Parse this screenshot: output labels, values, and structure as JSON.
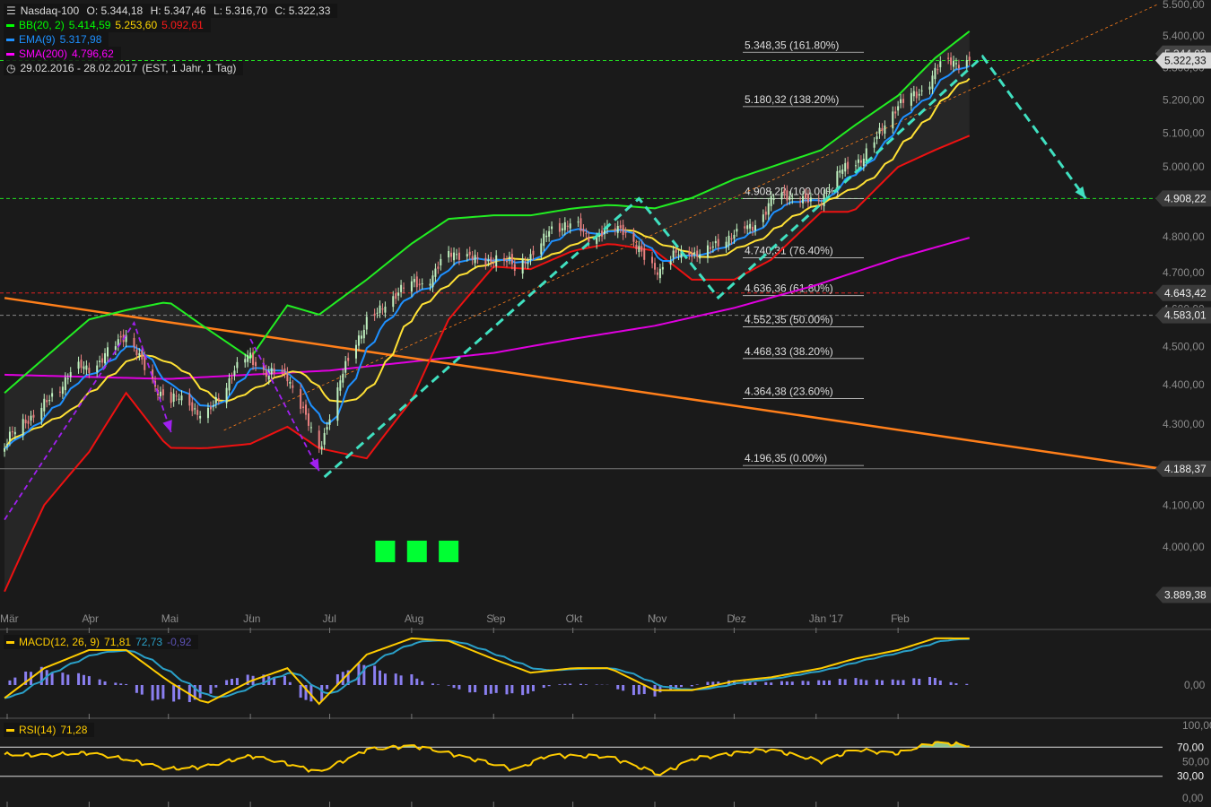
{
  "header": {
    "symbol": "Nasdaq-100",
    "open": "O: 5.344,18",
    "high": "H: 5.347,46",
    "low": "L: 5.316,70",
    "close": "C: 5.322,33",
    "range": "29.02.2016 - 28.02.2017",
    "range_info": "(EST, 1 Jahr, 1 Tag)",
    "indicators": [
      {
        "label": "BB(20, 2)",
        "values": [
          "5.414,59",
          "5.253,60",
          "5.092,61"
        ],
        "colors": [
          "#00ff00",
          "#ffd700",
          "#ff1a1a"
        ]
      },
      {
        "label": "EMA(9)",
        "values": [
          "5.317,98"
        ],
        "colors": [
          "#1e90ff"
        ]
      },
      {
        "label": "SMA(200)",
        "values": [
          "4.796,62"
        ],
        "colors": [
          "#ff00ff"
        ]
      }
    ]
  },
  "colors": {
    "background": "#1a1a1a",
    "bb_upper": "#22ee22",
    "bb_mid": "#ffe135",
    "bb_lower": "#ee1111",
    "ema": "#1e90ff",
    "sma": "#e000e0",
    "trend": "#ff7f1a",
    "arrow_cyan": "#40e0c0",
    "arrow_purple": "#a020f0",
    "macd": "#ffcc00",
    "signal": "#2aa0c8",
    "hist": "#8a7ff0",
    "rsi": "#ffcc00"
  },
  "chart_data": {
    "type": "candlestick",
    "y_scale": "log",
    "ylim": [
      3880,
      5500
    ],
    "x_range": [
      "2016-02-29",
      "2017-02-28"
    ],
    "x_ticks": [
      {
        "date": "2016-03-01",
        "label": "Mär"
      },
      {
        "date": "2016-04-01",
        "label": "Apr"
      },
      {
        "date": "2016-05-01",
        "label": "Mai"
      },
      {
        "date": "2016-06-01",
        "label": "Jun"
      },
      {
        "date": "2016-07-01",
        "label": "Jul"
      },
      {
        "date": "2016-08-01",
        "label": "Aug"
      },
      {
        "date": "2016-09-01",
        "label": "Sep"
      },
      {
        "date": "2016-10-01",
        "label": "Okt"
      },
      {
        "date": "2016-11-01",
        "label": "Nov"
      },
      {
        "date": "2016-12-01",
        "label": "Dez"
      },
      {
        "date": "2017-01-01",
        "label": "Jan '17"
      },
      {
        "date": "2017-02-01",
        "label": "Feb"
      }
    ],
    "y_ticks": [
      {
        "value": 5500,
        "label": "5.500,00"
      },
      {
        "value": 5400,
        "label": "5.400,00"
      },
      {
        "value": 5300,
        "label": "5.300,00"
      },
      {
        "value": 5200,
        "label": "5.200,00"
      },
      {
        "value": 5100,
        "label": "5.100,00"
      },
      {
        "value": 5000,
        "label": "5.000,00"
      },
      {
        "value": 4800,
        "label": "4.800,00"
      },
      {
        "value": 4700,
        "label": "4.700,00"
      },
      {
        "value": 4600,
        "label": "4.600,00"
      },
      {
        "value": 4500,
        "label": "4.500,00"
      },
      {
        "value": 4400,
        "label": "4.400,00"
      },
      {
        "value": 4300,
        "label": "4.300,00"
      },
      {
        "value": 4100,
        "label": "4.100,00"
      },
      {
        "value": 4000,
        "label": "4.000,00"
      }
    ],
    "close": [
      [
        "2016-02-29",
        4239
      ],
      [
        "2016-03-15",
        4360
      ],
      [
        "2016-04-01",
        4455
      ],
      [
        "2016-04-15",
        4520
      ],
      [
        "2016-05-01",
        4360
      ],
      [
        "2016-05-15",
        4330
      ],
      [
        "2016-06-01",
        4475
      ],
      [
        "2016-06-15",
        4410
      ],
      [
        "2016-06-27",
        4250
      ],
      [
        "2016-07-15",
        4580
      ],
      [
        "2016-08-01",
        4660
      ],
      [
        "2016-08-15",
        4740
      ],
      [
        "2016-09-01",
        4745
      ],
      [
        "2016-09-09",
        4700
      ],
      [
        "2016-09-22",
        4820
      ],
      [
        "2016-10-03",
        4820
      ],
      [
        "2016-10-20",
        4810
      ],
      [
        "2016-11-03",
        4709
      ],
      [
        "2016-11-15",
        4760
      ],
      [
        "2016-12-01",
        4790
      ],
      [
        "2016-12-15",
        4900
      ],
      [
        "2017-01-03",
        4915
      ],
      [
        "2017-01-15",
        5008
      ],
      [
        "2017-02-01",
        5170
      ],
      [
        "2017-02-15",
        5290
      ],
      [
        "2017-02-28",
        5322.33
      ]
    ],
    "bb_upper": [
      [
        "2016-02-29",
        4379
      ],
      [
        "2016-03-15",
        4469
      ],
      [
        "2016-04-01",
        4572
      ],
      [
        "2016-04-15",
        4597
      ],
      [
        "2016-05-01",
        4620
      ],
      [
        "2016-05-15",
        4550
      ],
      [
        "2016-06-01",
        4469
      ],
      [
        "2016-06-15",
        4610
      ],
      [
        "2016-06-27",
        4585
      ],
      [
        "2016-07-15",
        4680
      ],
      [
        "2016-08-01",
        4780
      ],
      [
        "2016-08-15",
        4850
      ],
      [
        "2016-09-01",
        4860
      ],
      [
        "2016-09-15",
        4860
      ],
      [
        "2016-10-01",
        4880
      ],
      [
        "2016-10-15",
        4890
      ],
      [
        "2016-11-01",
        4880
      ],
      [
        "2016-11-15",
        4910
      ],
      [
        "2016-12-01",
        4964
      ],
      [
        "2016-12-15",
        5000
      ],
      [
        "2017-01-03",
        5050
      ],
      [
        "2017-01-15",
        5120
      ],
      [
        "2017-02-01",
        5214
      ],
      [
        "2017-02-15",
        5330
      ],
      [
        "2017-02-28",
        5414.59
      ]
    ],
    "bb_lower": [
      [
        "2016-02-29",
        3897
      ],
      [
        "2016-03-15",
        4100
      ],
      [
        "2016-04-01",
        4230
      ],
      [
        "2016-04-15",
        4379
      ],
      [
        "2016-05-01",
        4240
      ],
      [
        "2016-05-15",
        4239
      ],
      [
        "2016-06-01",
        4250
      ],
      [
        "2016-06-15",
        4293
      ],
      [
        "2016-06-27",
        4239
      ],
      [
        "2016-07-15",
        4214
      ],
      [
        "2016-08-01",
        4360
      ],
      [
        "2016-08-15",
        4572
      ],
      [
        "2016-09-01",
        4716
      ],
      [
        "2016-09-15",
        4709
      ],
      [
        "2016-10-01",
        4760
      ],
      [
        "2016-10-15",
        4780
      ],
      [
        "2016-11-01",
        4760
      ],
      [
        "2016-11-15",
        4680
      ],
      [
        "2016-12-01",
        4680
      ],
      [
        "2016-12-15",
        4735
      ],
      [
        "2017-01-03",
        4870
      ],
      [
        "2017-01-15",
        4870
      ],
      [
        "2017-02-01",
        5000
      ],
      [
        "2017-02-15",
        5050
      ],
      [
        "2017-02-28",
        5092.61
      ]
    ],
    "sma200": [
      [
        "2016-02-29",
        4426
      ],
      [
        "2016-05-01",
        4415
      ],
      [
        "2016-07-01",
        4437
      ],
      [
        "2016-08-01",
        4460
      ],
      [
        "2016-09-01",
        4483
      ],
      [
        "2016-10-01",
        4520
      ],
      [
        "2016-11-01",
        4555
      ],
      [
        "2016-12-01",
        4603
      ],
      [
        "2017-01-01",
        4665
      ],
      [
        "2017-02-01",
        4740
      ],
      [
        "2017-02-28",
        4796.62
      ]
    ],
    "horizontal_lines": [
      {
        "value": 5322.33,
        "label": "5.322,33",
        "color": "#22dd22",
        "style": "dashed",
        "badge_bg": "#d8d8d8",
        "badge_fg": "#111"
      },
      {
        "value": 4908.22,
        "label": "4.908,22",
        "color": "#22dd22",
        "style": "dashed",
        "badge_bg": "#3a3a3a",
        "badge_fg": "#eee"
      },
      {
        "value": 4643.42,
        "label": "4.643,42",
        "color": "#dd2222",
        "style": "dashed",
        "badge_bg": "#3a3a3a",
        "badge_fg": "#eee"
      },
      {
        "value": 4583.01,
        "label": "4.583,01",
        "color": "#888888",
        "style": "dashed",
        "badge_bg": "#3a3a3a",
        "badge_fg": "#eee"
      },
      {
        "value": 4188.37,
        "label": "4.188,37",
        "color": "#777777",
        "style": "solid",
        "badge_bg": "#3a3a3a",
        "badge_fg": "#eee"
      },
      {
        "value": 3889.38,
        "label": "3.889,38",
        "color": "none",
        "style": "none",
        "badge_bg": "#3a3a3a",
        "badge_fg": "#eee"
      }
    ],
    "high_badge": "5.344,03",
    "fibonacci": [
      {
        "value": 5348.35,
        "label": "5.348,35 (161.80%)"
      },
      {
        "value": 5180.32,
        "label": "5.180,32 (138.20%)"
      },
      {
        "value": 4908.22,
        "label": "4.908,22 (100.00%)"
      },
      {
        "value": 4740.31,
        "label": "4.740,31 (76.40%)"
      },
      {
        "value": 4636.36,
        "label": "4.636,36 (61.80%)"
      },
      {
        "value": 4552.35,
        "label": "4.552,35 (50.00%)"
      },
      {
        "value": 4468.33,
        "label": "4.468,33 (38.20%)"
      },
      {
        "value": 4364.38,
        "label": "4.364,38 (23.60%)"
      },
      {
        "value": 4196.35,
        "label": "4.196,35 (0.00%)"
      }
    ],
    "trendlines": [
      {
        "points": [
          [
            "2016-02-29",
            4630
          ],
          [
            "2017-05-10",
            4190
          ]
        ],
        "color": "#ff7f1a",
        "style": "solid"
      },
      {
        "points": [
          [
            "2016-05-22",
            4284
          ],
          [
            "2017-05-10",
            5500
          ]
        ],
        "color": "#ff7f1a",
        "style": "thin-dashed"
      }
    ],
    "arrows": [
      {
        "points": [
          [
            "2016-06-29",
            4168
          ],
          [
            "2016-10-26",
            4908
          ],
          [
            "2016-11-25",
            4631
          ],
          [
            "2017-03-05",
            5335
          ],
          [
            "2017-04-13",
            4908
          ]
        ],
        "color": "#40e0c0"
      },
      {
        "points": [
          [
            "2016-02-29",
            4065
          ],
          [
            "2016-04-18",
            4563
          ],
          [
            "2016-05-02",
            4279
          ]
        ],
        "color": "#a020f0"
      },
      {
        "points": [
          [
            "2016-06-01",
            4520
          ],
          [
            "2016-06-27",
            4183
          ]
        ],
        "color": "#a020f0"
      }
    ],
    "markers": [
      {
        "date": "2016-07-22",
        "value": 3990,
        "color": "#00ff33"
      },
      {
        "date": "2016-08-03",
        "value": 3990,
        "color": "#00ff33"
      },
      {
        "date": "2016-08-15",
        "value": 3990,
        "color": "#00ff33"
      }
    ]
  },
  "macd": {
    "label": "MACD(12, 26, 9)",
    "macd_value": "71,81",
    "signal_value": "72,73",
    "hist_value": "-0,92",
    "zero_label": "0,00",
    "macd": [
      [
        "2016-02-29",
        -20
      ],
      [
        "2016-03-15",
        26
      ],
      [
        "2016-04-01",
        54
      ],
      [
        "2016-04-15",
        54
      ],
      [
        "2016-05-01",
        6
      ],
      [
        "2016-05-15",
        -29
      ],
      [
        "2016-06-01",
        6
      ],
      [
        "2016-06-15",
        26
      ],
      [
        "2016-06-27",
        -29
      ],
      [
        "2016-07-15",
        47
      ],
      [
        "2016-08-01",
        72
      ],
      [
        "2016-08-15",
        68
      ],
      [
        "2016-09-01",
        40
      ],
      [
        "2016-09-15",
        19
      ],
      [
        "2016-10-01",
        26
      ],
      [
        "2016-10-15",
        26
      ],
      [
        "2016-11-01",
        -8
      ],
      [
        "2016-11-15",
        -8
      ],
      [
        "2016-12-01",
        6
      ],
      [
        "2016-12-15",
        12
      ],
      [
        "2017-01-03",
        26
      ],
      [
        "2017-01-15",
        40
      ],
      [
        "2017-02-01",
        54
      ],
      [
        "2017-02-15",
        72
      ],
      [
        "2017-02-28",
        71.81
      ]
    ]
  },
  "rsi": {
    "label": "RSI(14)",
    "value": "71,28",
    "ticks": [
      {
        "value": 100,
        "label": "100,00"
      },
      {
        "value": 70,
        "label": "70,00"
      },
      {
        "value": 50,
        "label": "50,00"
      },
      {
        "value": 30,
        "label": "30,00"
      },
      {
        "value": 0,
        "label": "0,00"
      }
    ],
    "series": [
      [
        "2016-02-29",
        60
      ],
      [
        "2016-04-01",
        62
      ],
      [
        "2016-05-01",
        40
      ],
      [
        "2016-05-15",
        45
      ],
      [
        "2016-06-01",
        58
      ],
      [
        "2016-06-27",
        35
      ],
      [
        "2016-07-15",
        68
      ],
      [
        "2016-08-01",
        72
      ],
      [
        "2016-08-15",
        60
      ],
      [
        "2016-09-09",
        40
      ],
      [
        "2016-09-22",
        60
      ],
      [
        "2016-10-15",
        55
      ],
      [
        "2016-11-03",
        32
      ],
      [
        "2016-11-15",
        55
      ],
      [
        "2016-12-01",
        62
      ],
      [
        "2016-12-15",
        65
      ],
      [
        "2017-01-03",
        50
      ],
      [
        "2017-01-15",
        68
      ],
      [
        "2017-02-01",
        62
      ],
      [
        "2017-02-15",
        75
      ],
      [
        "2017-02-28",
        71.28
      ]
    ]
  }
}
